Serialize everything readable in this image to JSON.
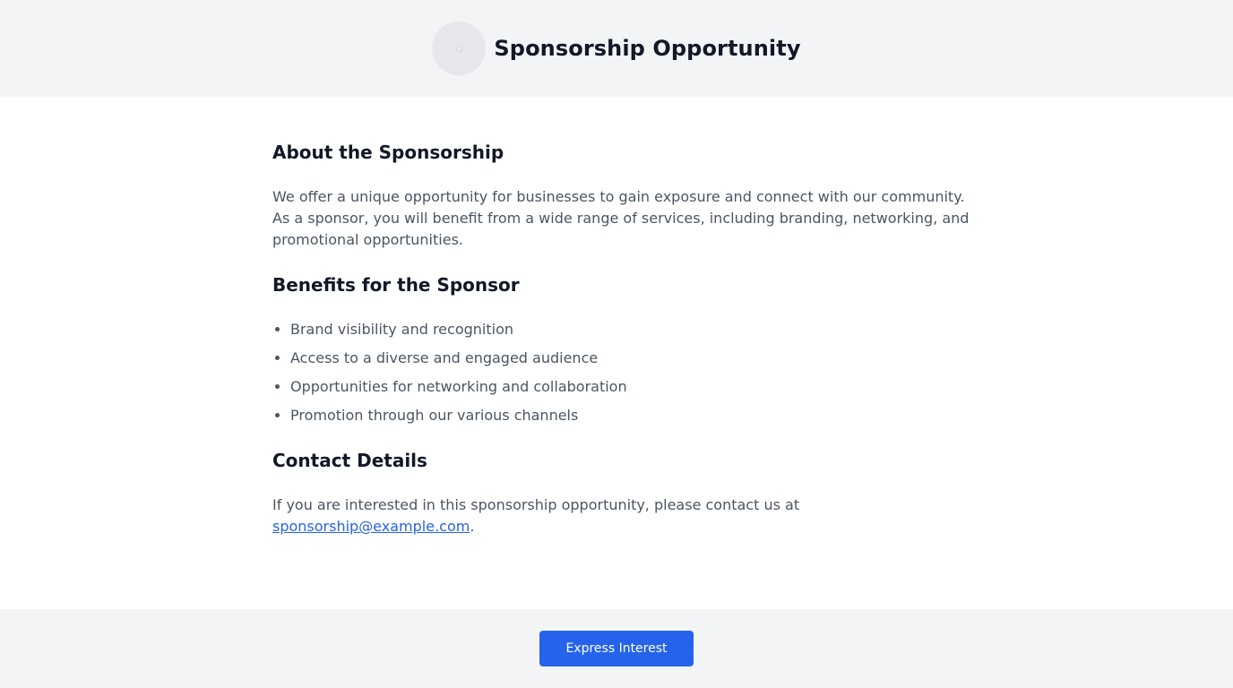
{
  "header": {
    "logo_icon": "logo-icon",
    "title": "Sponsorship Opportunity"
  },
  "about": {
    "heading": "About the Sponsorship",
    "text": "We offer a unique opportunity for businesses to gain exposure and connect with our community. As a sponsor, you will benefit from a wide range of services, including branding, networking, and promotional opportunities."
  },
  "benefits": {
    "heading": "Benefits for the Sponsor",
    "items": [
      "Brand visibility and recognition",
      "Access to a diverse and engaged audience",
      "Opportunities for networking and collaboration",
      "Promotion through our various channels"
    ]
  },
  "contact": {
    "heading": "Contact Details",
    "text_before": "If you are interested in this sponsorship opportunity, please contact us at",
    "email": "sponsorship@example.com",
    "text_after": "."
  },
  "footer": {
    "button_label": "Express Interest"
  },
  "colors": {
    "accent": "#2563eb",
    "header_bg": "#f3f4f6",
    "heading_text": "#111827",
    "body_text": "#4b5563"
  }
}
